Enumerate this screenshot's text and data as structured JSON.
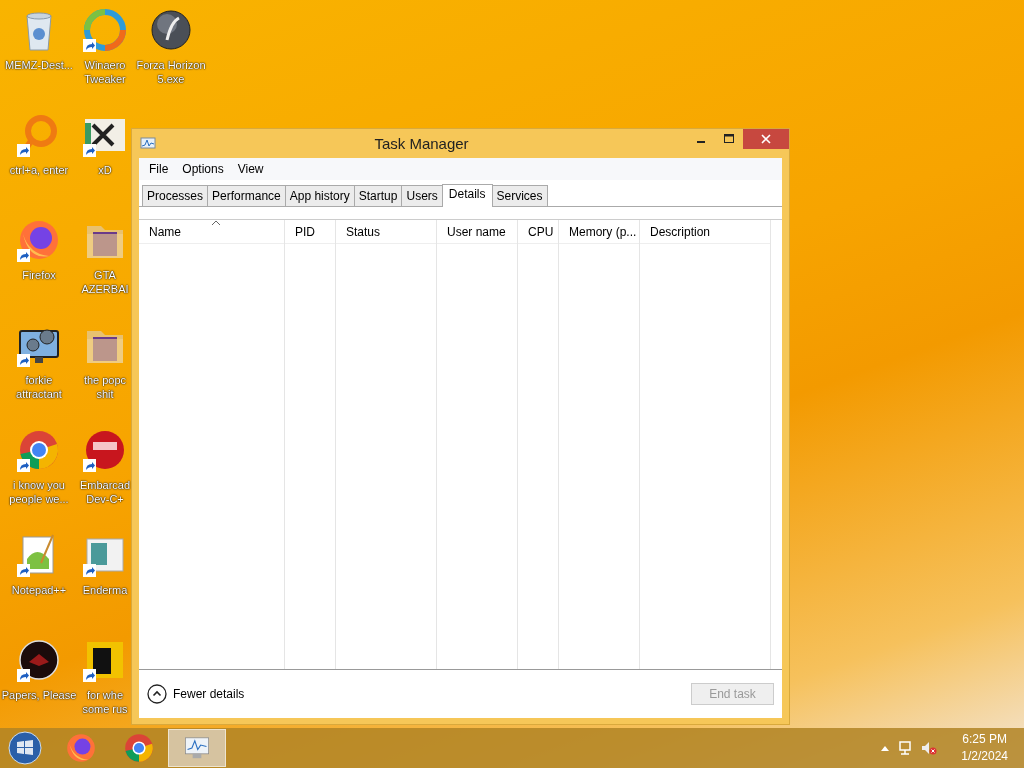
{
  "desktop_columns": [
    [
      {
        "kind": "bin",
        "label": "MEMZ-Dest...",
        "shortcut": false
      },
      {
        "kind": "ring",
        "label": "ctrl+a, enter",
        "shortcut": true
      },
      {
        "kind": "fox",
        "label": "Firefox",
        "shortcut": true
      },
      {
        "kind": "monitor",
        "label": "forkie\nattractant",
        "shortcut": true
      },
      {
        "kind": "chrome",
        "label": "i know you\npeople we...",
        "shortcut": true
      },
      {
        "kind": "notepad",
        "label": "Notepad++",
        "shortcut": true
      },
      {
        "kind": "dark",
        "label": "Papers, Please",
        "shortcut": true
      }
    ],
    [
      {
        "kind": "swirl",
        "label": "Winaero\nTweaker",
        "shortcut": true
      },
      {
        "kind": "tile",
        "label": "xD",
        "shortcut": true
      },
      {
        "kind": "folder",
        "label": "GTA\nAZERBAI",
        "shortcut": false
      },
      {
        "kind": "folder",
        "label": "the popc\nshit",
        "shortcut": false
      },
      {
        "kind": "red",
        "label": "Embarcad\nDev-C+",
        "shortcut": true
      },
      {
        "kind": "doc",
        "label": "Enderma",
        "shortcut": true
      },
      {
        "kind": "yellow",
        "label": "for whe\nsome rus",
        "shortcut": true
      }
    ],
    [
      {
        "kind": "disc",
        "label": "Forza Horizon\n5.exe",
        "shortcut": false
      }
    ]
  ],
  "window": {
    "title": "Task Manager",
    "menu": [
      "File",
      "Options",
      "View"
    ],
    "tabs": [
      {
        "label": "Processes",
        "selected": false
      },
      {
        "label": "Performance",
        "selected": false
      },
      {
        "label": "App history",
        "selected": false
      },
      {
        "label": "Startup",
        "selected": false
      },
      {
        "label": "Users",
        "selected": false
      },
      {
        "label": "Details",
        "selected": true
      },
      {
        "label": "Services",
        "selected": false
      }
    ],
    "table": {
      "columns": [
        {
          "label": "Name",
          "sorted": true
        },
        {
          "label": "PID",
          "sorted": false
        },
        {
          "label": "Status",
          "sorted": false
        },
        {
          "label": "User name",
          "sorted": false
        },
        {
          "label": "CPU",
          "sorted": false
        },
        {
          "label": "Memory (p...",
          "sorted": false
        },
        {
          "label": "Description",
          "sorted": false
        }
      ]
    },
    "fewer_details": "Fewer details",
    "end_task": {
      "label": "End task",
      "disabled": true
    }
  },
  "taskbar": {
    "apps": [
      {
        "kind": "fox",
        "active": false
      },
      {
        "kind": "chrome",
        "active": false
      },
      {
        "kind": "taskmgr",
        "active": true
      }
    ],
    "time": "6:25 PM",
    "date": "1/2/2024"
  }
}
